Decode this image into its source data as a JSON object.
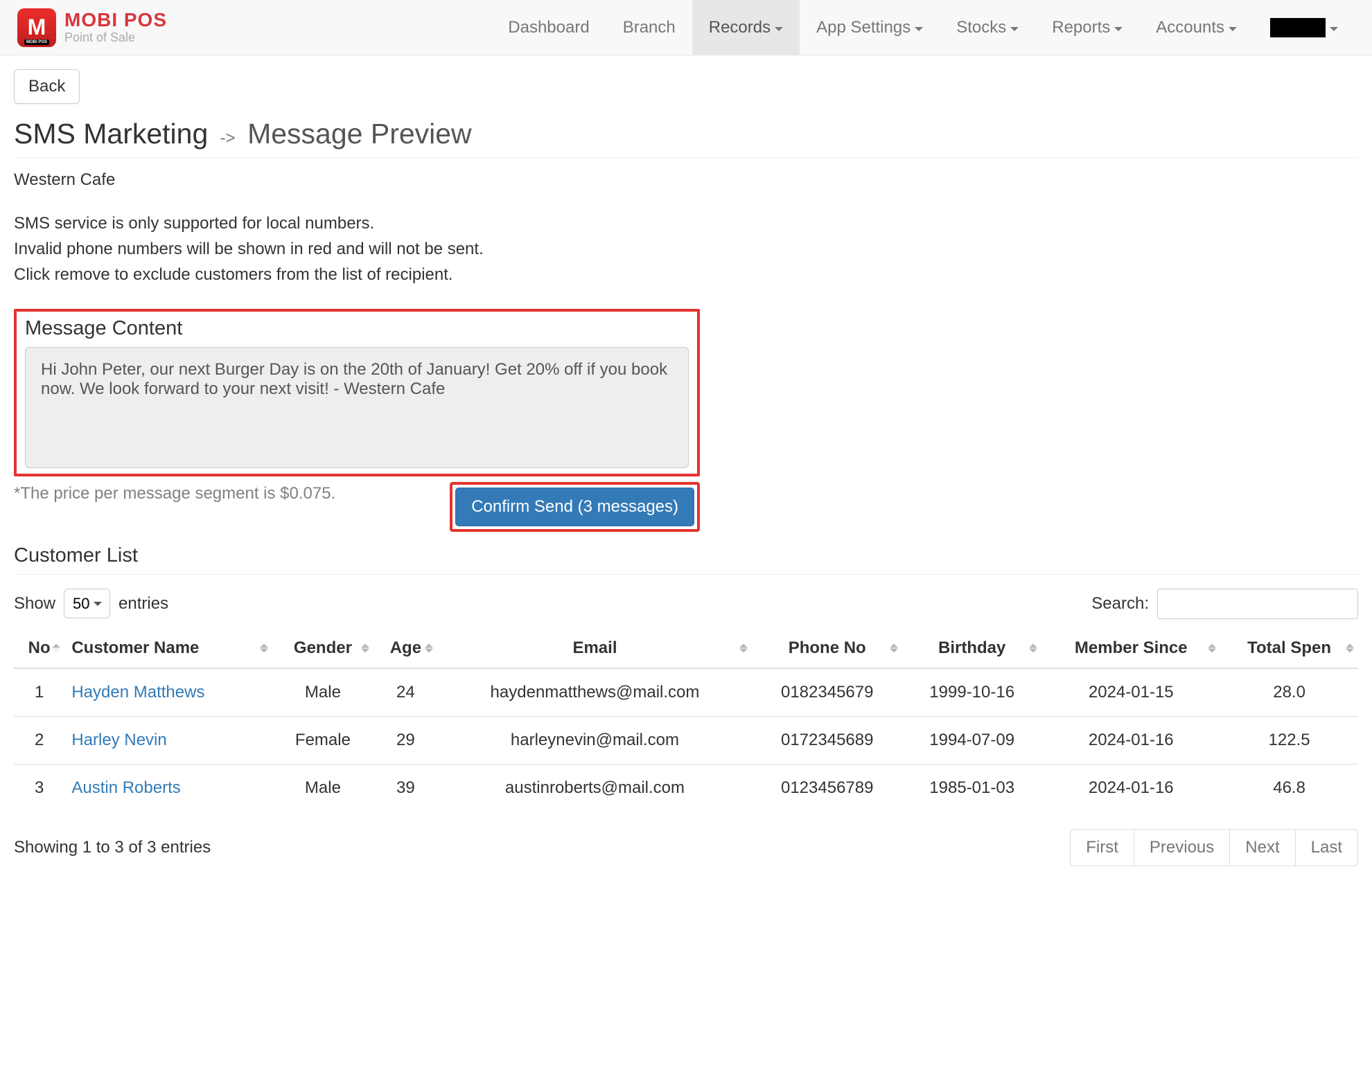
{
  "brand": {
    "name": "MOBI POS",
    "tagline": "Point of Sale"
  },
  "nav": {
    "items": [
      "Dashboard",
      "Branch",
      "Records",
      "App Settings",
      "Stocks",
      "Reports",
      "Accounts"
    ],
    "active_index": 2,
    "has_caret": [
      false,
      false,
      true,
      true,
      true,
      true,
      true
    ]
  },
  "back_label": "Back",
  "page": {
    "main": "SMS Marketing",
    "sub": "Message Preview",
    "arrow": "->"
  },
  "branch": "Western Cafe",
  "info": {
    "l1": "SMS service is only supported for local numbers.",
    "l2": "Invalid phone numbers will be shown in red and will not be sent.",
    "l3": "Click remove to exclude customers from the list of recipient."
  },
  "message": {
    "heading": "Message Content",
    "body": "Hi John Peter, our next Burger Day is on the 20th of January! Get 20% off if you book now. We look forward to your next visit! - Western Cafe",
    "price_note": "*The price per message segment is $0.075.",
    "confirm_label": "Confirm Send (3 messages)"
  },
  "customer_list_heading": "Customer List",
  "table": {
    "show_label_pre": "Show",
    "show_label_post": "entries",
    "show_value": "50",
    "search_label": "Search:",
    "columns": [
      "No",
      "Customer Name",
      "Gender",
      "Age",
      "Email",
      "Phone No",
      "Birthday",
      "Member Since",
      "Total Spen"
    ],
    "rows": [
      {
        "no": "1",
        "name": "Hayden Matthews",
        "gender": "Male",
        "age": "24",
        "email": "haydenmatthews@mail.com",
        "phone": "0182345679",
        "birthday": "1999-10-16",
        "member": "2024-01-15",
        "spend": "28.0"
      },
      {
        "no": "2",
        "name": "Harley Nevin",
        "gender": "Female",
        "age": "29",
        "email": "harleynevin@mail.com",
        "phone": "0172345689",
        "birthday": "1994-07-09",
        "member": "2024-01-16",
        "spend": "122.5"
      },
      {
        "no": "3",
        "name": "Austin Roberts",
        "gender": "Male",
        "age": "39",
        "email": "austinroberts@mail.com",
        "phone": "0123456789",
        "birthday": "1985-01-03",
        "member": "2024-01-16",
        "spend": "46.8"
      }
    ],
    "info_text": "Showing 1 to 3 of 3 entries",
    "pagination": [
      "First",
      "Previous",
      "Next",
      "Last"
    ]
  }
}
